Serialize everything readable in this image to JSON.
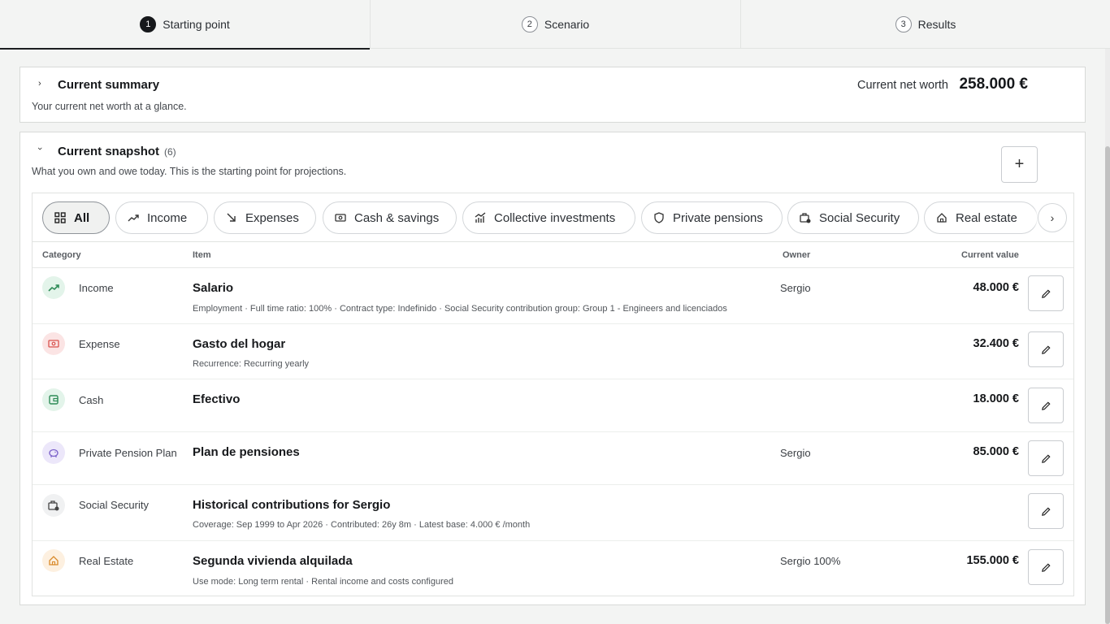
{
  "stepper": [
    {
      "num": "1",
      "label": "Starting point"
    },
    {
      "num": "2",
      "label": "Scenario"
    },
    {
      "num": "3",
      "label": "Results"
    }
  ],
  "summary": {
    "title": "Current summary",
    "subtitle": "Your current net worth at a glance.",
    "net_worth_label": "Current net worth",
    "net_worth_value": "258.000 €"
  },
  "snapshot": {
    "title": "Current snapshot",
    "count": "(6)",
    "subtitle": "What you own and owe today. This is the starting point for projections.",
    "add_label": "+",
    "filters": [
      {
        "label": "All",
        "icon": "grid-icon",
        "active": true
      },
      {
        "label": "Income",
        "icon": "trending-up-icon"
      },
      {
        "label": "Expenses",
        "icon": "arrow-down-right-icon"
      },
      {
        "label": "Cash & savings",
        "icon": "banknote-icon"
      },
      {
        "label": "Collective investments",
        "icon": "chart-icon"
      },
      {
        "label": "Private pensions",
        "icon": "shield-icon"
      },
      {
        "label": "Social Security",
        "icon": "briefcase-clock-icon"
      },
      {
        "label": "Real estate",
        "icon": "home-icon"
      }
    ],
    "columns": {
      "category": "Category",
      "item": "Item",
      "owner": "Owner",
      "value": "Current value"
    },
    "rows": [
      {
        "category": "Income",
        "icon": "trending-up-icon",
        "title": "Salario",
        "meta": "Employment  ·  Full time ratio: 100%  ·  Contract type: Indefinido  ·  Social Security contribution group: Group 1 - Engineers and licenciados",
        "owner": "Sergio",
        "value": "48.000 €",
        "color": "#2e8b57"
      },
      {
        "category": "Expense",
        "icon": "banknote-icon",
        "title": "Gasto del hogar",
        "meta": "Recurrence: Recurring yearly",
        "owner": "",
        "value": "32.400 €",
        "color": "#d9534f"
      },
      {
        "category": "Cash",
        "icon": "wallet-icon",
        "title": "Efectivo",
        "meta": "",
        "owner": "",
        "value": "18.000 €",
        "color": "#2e8b57"
      },
      {
        "category": "Private Pension Plan",
        "icon": "piggy-bank-icon",
        "title": "Plan de pensiones",
        "meta": "",
        "owner": "Sergio",
        "value": "85.000 €",
        "color": "#7b61c9"
      },
      {
        "category": "Social Security",
        "icon": "briefcase-clock-icon",
        "title": "Historical contributions for Sergio",
        "meta": "Coverage: Sep 1999 to Apr 2026  ·  Contributed: 26y 8m  ·  Latest base: 4.000 € /month",
        "owner": "",
        "value": "",
        "color": "#444444"
      },
      {
        "category": "Real Estate",
        "icon": "home-icon",
        "title": "Segunda vivienda alquilada",
        "meta": "Use mode: Long term rental  ·  Rental income and costs configured",
        "owner": "Sergio 100%",
        "value": "155.000 €",
        "color": "#d98a2b"
      }
    ]
  }
}
